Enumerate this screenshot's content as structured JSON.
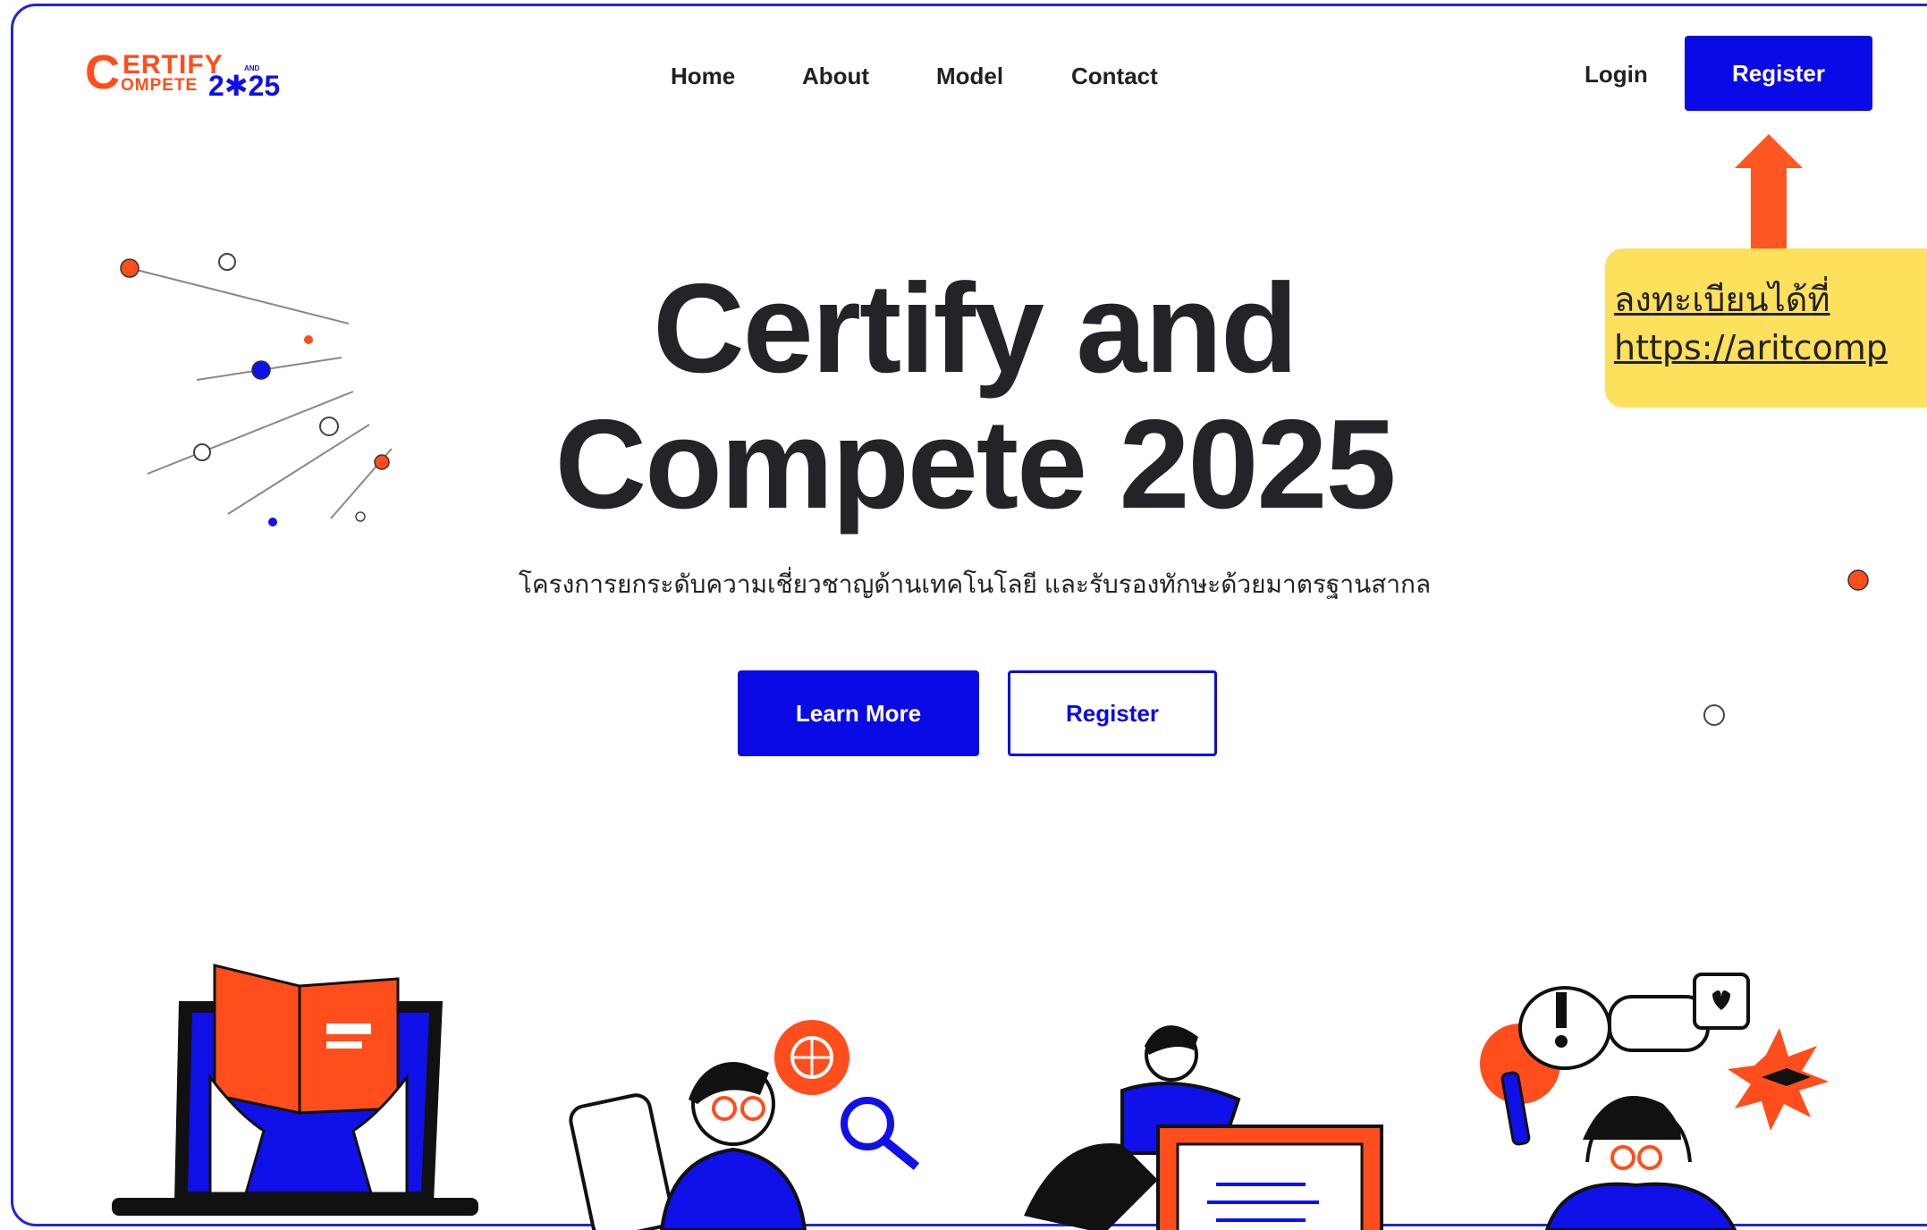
{
  "brand": {
    "logo_c": "C",
    "logo_line1": "ERTIFY",
    "logo_line2": "OMPETE",
    "logo_and": "AND",
    "logo_year": "2✱25"
  },
  "nav": {
    "items": [
      "Home",
      "About",
      "Model",
      "Contact"
    ],
    "login": "Login",
    "register": "Register"
  },
  "hero": {
    "title_line1": "Certify and",
    "title_line2": "Compete 2025",
    "subtitle": "โครงการยกระดับความเชี่ยวชาญด้านเทคโนโลยี และรับรองทักษะด้วยมาตรฐานสากล",
    "learn_more": "Learn More",
    "register": "Register"
  },
  "callout": {
    "line1": "ลงทะเบียนได้ที่",
    "line2": " https://aritcomp"
  },
  "colors": {
    "primary": "#0a0ae6",
    "accent": "#ff4d1c",
    "callout_bg": "#fde05c",
    "frame": "#2323d8"
  },
  "illustrations": [
    "laptop-book-illustration",
    "researcher-illustration",
    "certificate-illustration",
    "celebration-illustration"
  ]
}
